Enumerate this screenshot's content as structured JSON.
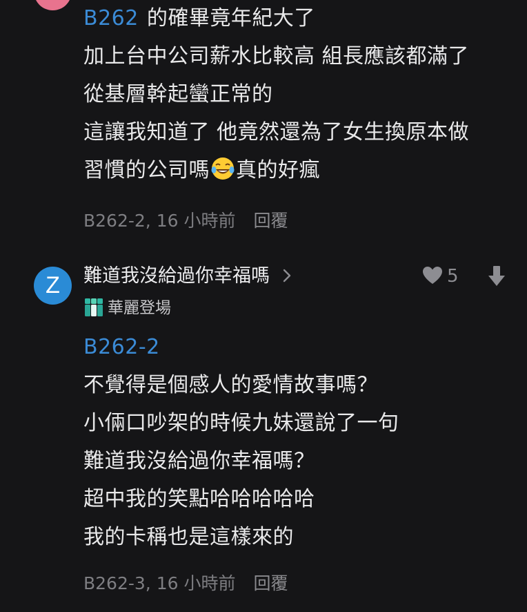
{
  "colors": {
    "background": "#151517",
    "text": "#e9e9ea",
    "mention": "#3b8bd6",
    "meta": "#7e7e82",
    "avatar_top": "#e8738e",
    "avatar_z": "#2a8bd6",
    "board_icon": "#2fb8a3"
  },
  "comment1": {
    "mention": "B262",
    "line1_rest": "的確畢竟年紀大了",
    "line2": "加上台中公司薪水比較高 組長應該都滿了",
    "line3": "從基層幹起蠻正常的",
    "line4": "這讓我知道了 他竟然還為了女生換原本做",
    "line5_before": "習慣的公司嗎",
    "line5_emoji": "laughing-tears-emoji",
    "line5_after": "真的好瘋",
    "meta": "B262-2, 16 小時前",
    "reply_label": "回覆"
  },
  "comment2": {
    "avatar_letter": "Z",
    "author": "難道我沒給過你幸福嗎",
    "author_chevron": "chevron-right-icon",
    "board_icon": "board-icon",
    "board": "華麗登場",
    "likes": "5",
    "like_icon": "heart-icon",
    "downvote_icon": "arrow-down-icon",
    "mention": "B262-2",
    "line1": "不覺得是個感人的愛情故事嗎？",
    "line2": "小倆口吵架的時候九妹還說了一句",
    "line3": "難道我沒給過你幸福嗎？",
    "line4": "超中我的笑點哈哈哈哈哈",
    "line5": "我的卡稱也是這樣來的",
    "meta": "B262-3, 16 小時前",
    "reply_label": "回覆"
  }
}
